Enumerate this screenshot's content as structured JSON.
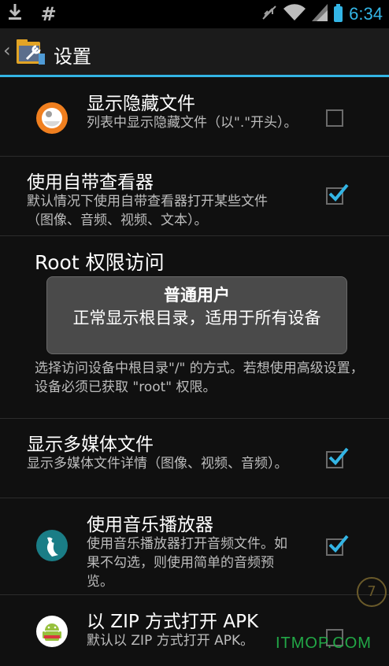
{
  "status_bar": {
    "left_icons": [
      "download-icon",
      "hash-icon"
    ],
    "right_icons": [
      "silent-icon",
      "wifi-icon",
      "signal-icon",
      "battery-icon"
    ],
    "time": "6:34",
    "accent": "#33b5e5"
  },
  "action_bar": {
    "back_glyph": "‹",
    "app_icon": "settings-folder-icon",
    "title": "设置"
  },
  "settings": [
    {
      "title": "显示隐藏文件",
      "summary": "列表中显示隐藏文件（以\".\"开头）。",
      "checked": false,
      "icon": "hidden-files-icon"
    },
    {
      "title": "使用自带查看器",
      "summary": "默认情况下使用自带查看器打开某些文件（图像、音频、视频、文本）。",
      "checked": true
    },
    {
      "title": "Root 权限访问",
      "summary": "选择访问设备中根目录\"/\" 的方式。若想使用高级设置，设备必须已获取 \"root\" 权限。"
    },
    {
      "title": "显示多媒体文件",
      "summary": "显示多媒体文件详情（图像、视频、音频）。",
      "checked": true
    },
    {
      "title": "使用音乐播放器",
      "summary": "使用音乐播放器打开音频文件。如果不勾选，则使用简单的音频预览。",
      "checked": true,
      "icon": "music-player-icon"
    },
    {
      "title": "以 ZIP 方式打开 APK",
      "summary": "默认以 ZIP 方式打开 APK。",
      "checked": false,
      "icon": "android-icon"
    }
  ],
  "toast": {
    "title": "普通用户",
    "message": "正常显示根目录，适用于所有设备"
  },
  "floating_badge": "7",
  "watermark": "ITMOP.COM"
}
